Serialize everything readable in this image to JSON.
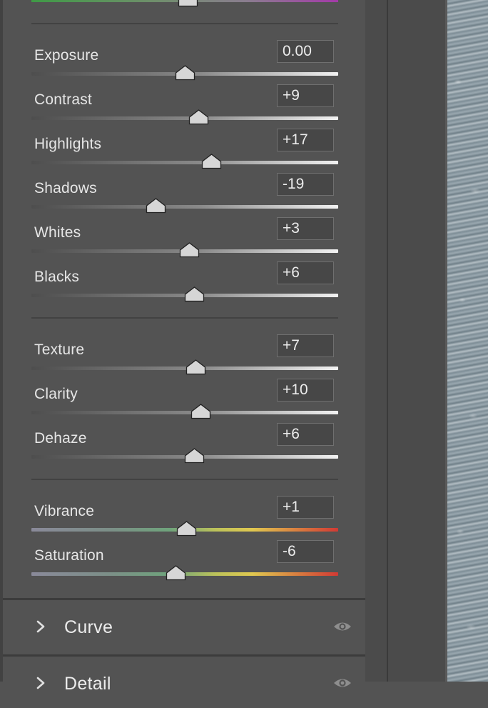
{
  "basic_sliders": [
    {
      "id": "exposure",
      "label": "Exposure",
      "value": "0.00",
      "position": 0.5
    },
    {
      "id": "contrast",
      "label": "Contrast",
      "value": "+9",
      "position": 0.545
    },
    {
      "id": "highlights",
      "label": "Highlights",
      "value": "+17",
      "position": 0.585
    },
    {
      "id": "shadows",
      "label": "Shadows",
      "value": "-19",
      "position": 0.405
    },
    {
      "id": "whites",
      "label": "Whites",
      "value": "+3",
      "position": 0.515
    },
    {
      "id": "blacks",
      "label": "Blacks",
      "value": "+6",
      "position": 0.53
    }
  ],
  "presence_sliders": [
    {
      "id": "texture",
      "label": "Texture",
      "value": "+7",
      "position": 0.535
    },
    {
      "id": "clarity",
      "label": "Clarity",
      "value": "+10",
      "position": 0.55
    },
    {
      "id": "dehaze",
      "label": "Dehaze",
      "value": "+6",
      "position": 0.53
    }
  ],
  "color_sliders": [
    {
      "id": "vibrance",
      "label": "Vibrance",
      "value": "+1",
      "position": 0.505
    },
    {
      "id": "saturation",
      "label": "Saturation",
      "value": "-6",
      "position": 0.47
    }
  ],
  "sections": [
    {
      "id": "curve",
      "title": "Curve",
      "icon": "chevron-right-icon",
      "visibility_icon": "eye-icon"
    },
    {
      "id": "detail",
      "title": "Detail",
      "icon": "chevron-right-icon",
      "visibility_icon": "eye-icon"
    }
  ],
  "top_slider": {
    "position": 0.51
  },
  "colors": {
    "panel_bg": "#535353",
    "field_bg": "#474747",
    "text": "#e6e6e6",
    "thumb_fill": "#d6d6d6",
    "thumb_stroke": "#222222"
  }
}
